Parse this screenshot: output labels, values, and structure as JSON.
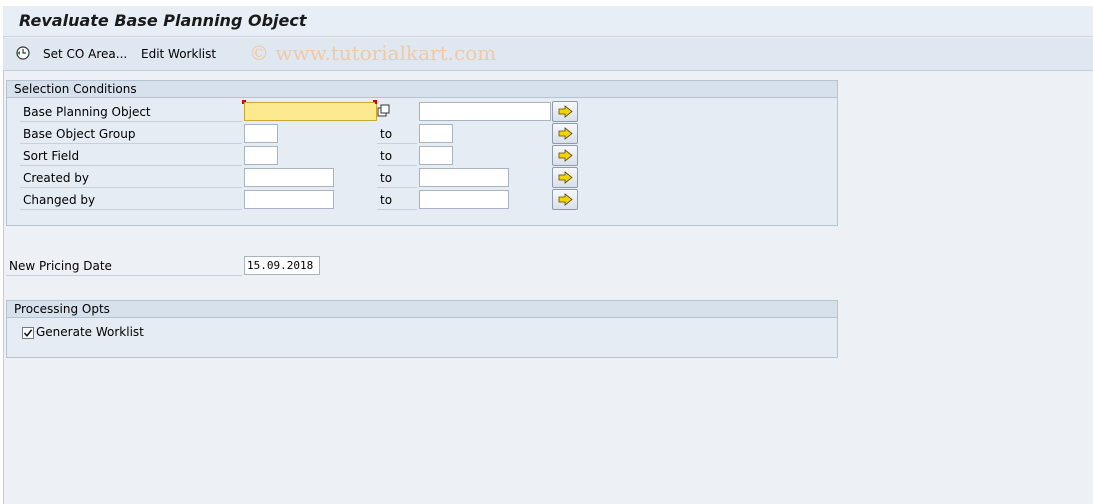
{
  "window": {
    "title": "Revaluate Base Planning Object"
  },
  "toolbar": {
    "set_co_area": "Set CO Area...",
    "edit_worklist": "Edit Worklist",
    "watermark": "© www.tutorialkart.com"
  },
  "selection_conditions": {
    "title": "Selection Conditions",
    "to_label": "to",
    "rows": [
      {
        "label": "Base Planning Object",
        "from": "",
        "to": ""
      },
      {
        "label": "Base Object Group",
        "from": "",
        "to": ""
      },
      {
        "label": "Sort Field",
        "from": "",
        "to": ""
      },
      {
        "label": "Created by",
        "from": "",
        "to": ""
      },
      {
        "label": "Changed by",
        "from": "",
        "to": ""
      }
    ]
  },
  "pricing": {
    "label": "New Pricing Date",
    "value": "15.09.2018"
  },
  "processing_opts": {
    "title": "Processing Opts",
    "generate_worklist_label": "Generate Worklist",
    "generate_worklist_checked": true
  },
  "colors": {
    "required_field": "#fde98f",
    "arrow": "#f2d500"
  }
}
